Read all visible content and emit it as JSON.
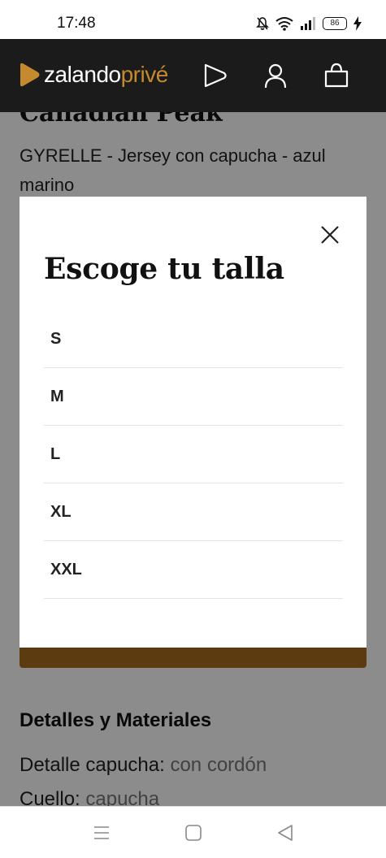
{
  "status_bar": {
    "time": "17:48",
    "battery_level": "86",
    "icons": [
      "bell-muted-icon",
      "wifi-icon",
      "signal-icon",
      "battery-icon",
      "charging-icon"
    ]
  },
  "header": {
    "logo_part1": "zalando",
    "logo_part2": "privé",
    "icons": [
      "play-icon",
      "user-icon",
      "bag-icon"
    ],
    "brand_color": "#c58a2e",
    "background": "#1b1b1b"
  },
  "product": {
    "brand": "Canadian Peak",
    "name": "GYRELLE - Jersey con capucha - azul marino"
  },
  "details": {
    "title": "Detalles y Materiales",
    "rows": [
      {
        "label": "Detalle capucha: ",
        "value": "con cordón"
      },
      {
        "label": "Cuello: ",
        "value": "capucha"
      }
    ]
  },
  "size_modal": {
    "title": "Escoge tu talla",
    "close_icon": "close-icon",
    "sizes": [
      "S",
      "M",
      "L",
      "XL",
      "XXL"
    ]
  },
  "nav_bar": {
    "icons": [
      "menu-icon",
      "home-icon",
      "back-icon"
    ]
  }
}
